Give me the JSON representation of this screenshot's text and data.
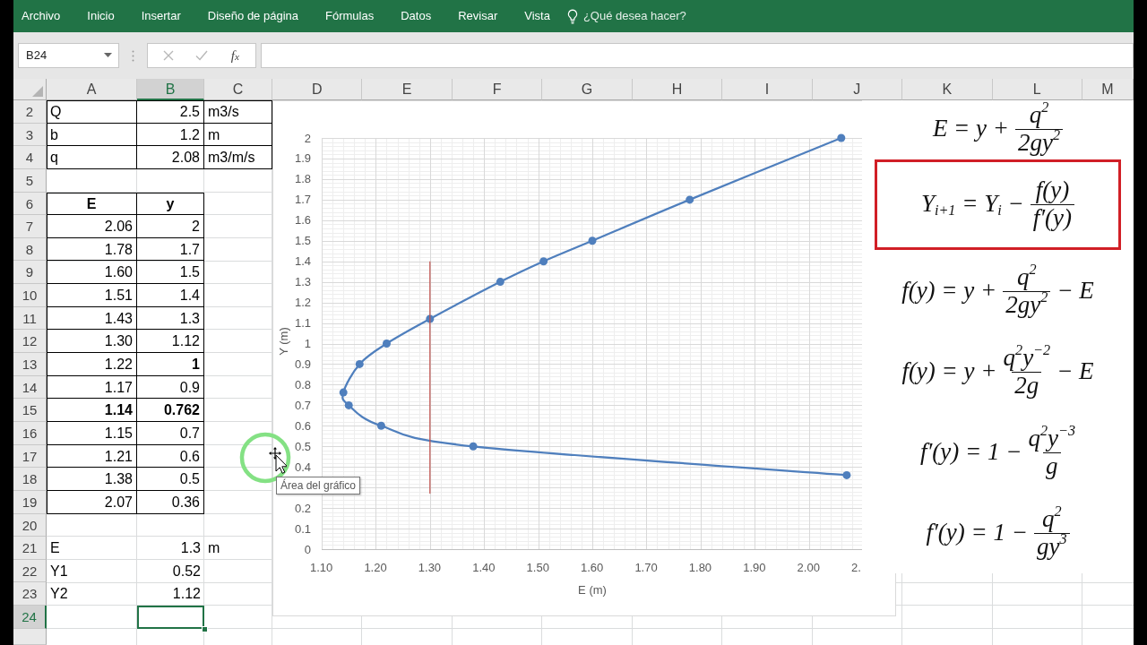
{
  "ribbon": {
    "tabs": [
      {
        "label": "Archivo",
        "selected": false
      },
      {
        "label": "Inicio",
        "selected": false
      },
      {
        "label": "Insertar",
        "selected": false
      },
      {
        "label": "Diseño de página",
        "selected": false
      },
      {
        "label": "Fórmulas",
        "selected": false
      },
      {
        "label": "Datos",
        "selected": false
      },
      {
        "label": "Revisar",
        "selected": false
      },
      {
        "label": "Vista",
        "selected": false
      }
    ],
    "tell_me": {
      "placeholder": "¿Qué desea hacer?"
    }
  },
  "formula_bar": {
    "name_box": "B24",
    "buttons": [
      {
        "kind": "cancel",
        "disabled": true
      },
      {
        "kind": "enter",
        "disabled": true
      },
      {
        "kind": "function",
        "label": "f$_{x}$",
        "disabled": false
      }
    ]
  },
  "sheet": {
    "columns": [
      {
        "label": "A",
        "selected": false
      },
      {
        "label": "B",
        "selected": true
      },
      {
        "label": "C",
        "selected": false
      },
      {
        "label": "D",
        "selected": false
      },
      {
        "label": "E",
        "selected": false
      },
      {
        "label": "F",
        "selected": false
      },
      {
        "label": "G",
        "selected": false
      },
      {
        "label": "H",
        "selected": false
      },
      {
        "label": "I",
        "selected": false
      },
      {
        "label": "J",
        "selected": false
      },
      {
        "label": "K",
        "selected": false
      },
      {
        "label": "L",
        "selected": false
      },
      {
        "label": "M",
        "selected": false
      }
    ],
    "rows": [
      {
        "number": "2",
        "selected": false,
        "cells": [
          {
            "text": "Q",
            "kind": "text",
            "bold": false,
            "border": true
          },
          {
            "text": "2.5",
            "kind": "number",
            "bold": false,
            "border": true
          },
          {
            "text": "m3/s",
            "kind": "text",
            "bold": false,
            "border": true
          }
        ]
      },
      {
        "number": "3",
        "selected": false,
        "cells": [
          {
            "text": "b",
            "kind": "text",
            "bold": false,
            "border": true
          },
          {
            "text": "1.2",
            "kind": "number",
            "bold": false,
            "border": true
          },
          {
            "text": "m",
            "kind": "text",
            "bold": false,
            "border": true
          }
        ]
      },
      {
        "number": "4",
        "selected": false,
        "cells": [
          {
            "text": "q",
            "kind": "text",
            "bold": false,
            "border": true
          },
          {
            "text": "2.08",
            "kind": "number",
            "bold": false,
            "border": true
          },
          {
            "text": "m3/m/s",
            "kind": "text",
            "bold": false,
            "border": true
          }
        ]
      },
      {
        "number": "5",
        "selected": false
      },
      {
        "number": "6",
        "selected": false,
        "cells": [
          {
            "text": "E",
            "kind": "heading",
            "bold": true,
            "border": true
          },
          {
            "text": "y",
            "kind": "heading",
            "bold": true,
            "border": true
          }
        ]
      },
      {
        "number": "7",
        "selected": false,
        "cells": [
          {
            "text": "2.06",
            "kind": "number",
            "bold": false,
            "border": true
          },
          {
            "text": "2",
            "kind": "number",
            "bold": false,
            "border": true
          }
        ]
      },
      {
        "number": "8",
        "selected": false,
        "cells": [
          {
            "text": "1.78",
            "kind": "number",
            "bold": false,
            "border": true
          },
          {
            "text": "1.7",
            "kind": "number",
            "bold": false,
            "border": true
          }
        ]
      },
      {
        "number": "9",
        "selected": false,
        "cells": [
          {
            "text": "1.60",
            "kind": "number",
            "bold": false,
            "border": true
          },
          {
            "text": "1.5",
            "kind": "number",
            "bold": false,
            "border": true
          }
        ]
      },
      {
        "number": "10",
        "selected": false,
        "cells": [
          {
            "text": "1.51",
            "kind": "number",
            "bold": false,
            "border": true
          },
          {
            "text": "1.4",
            "kind": "number",
            "bold": false,
            "border": true
          }
        ]
      },
      {
        "number": "11",
        "selected": false,
        "cells": [
          {
            "text": "1.43",
            "kind": "number",
            "bold": false,
            "border": true
          },
          {
            "text": "1.3",
            "kind": "number",
            "bold": false,
            "border": true
          }
        ]
      },
      {
        "number": "12",
        "selected": false,
        "cells": [
          {
            "text": "1.30",
            "kind": "number",
            "bold": false,
            "border": true
          },
          {
            "text": "1.12",
            "kind": "number",
            "bold": false,
            "border": true
          }
        ]
      },
      {
        "number": "13",
        "selected": false,
        "cells": [
          {
            "text": "1.22",
            "kind": "number",
            "bold": false,
            "border": true
          },
          {
            "text": "1",
            "kind": "number",
            "bold": true,
            "border": true
          }
        ]
      },
      {
        "number": "14",
        "selected": false,
        "cells": [
          {
            "text": "1.17",
            "kind": "number",
            "bold": false,
            "border": true
          },
          {
            "text": "0.9",
            "kind": "number",
            "bold": false,
            "border": true
          }
        ]
      },
      {
        "number": "15",
        "selected": false,
        "cells": [
          {
            "text": "1.14",
            "kind": "number",
            "bold": true,
            "border": true
          },
          {
            "text": "0.762",
            "kind": "number",
            "bold": true,
            "border": true
          }
        ]
      },
      {
        "number": "16",
        "selected": false,
        "cells": [
          {
            "text": "1.15",
            "kind": "number",
            "bold": false,
            "border": true
          },
          {
            "text": "0.7",
            "kind": "number",
            "bold": false,
            "border": true
          }
        ]
      },
      {
        "number": "17",
        "selected": false,
        "cells": [
          {
            "text": "1.21",
            "kind": "number",
            "bold": false,
            "border": true
          },
          {
            "text": "0.6",
            "kind": "number",
            "bold": false,
            "border": true
          }
        ]
      },
      {
        "number": "18",
        "selected": false,
        "cells": [
          {
            "text": "1.38",
            "kind": "number",
            "bold": false,
            "border": true
          },
          {
            "text": "0.5",
            "kind": "number",
            "bold": false,
            "border": true
          }
        ]
      },
      {
        "number": "19",
        "selected": false,
        "cells": [
          {
            "text": "2.07",
            "kind": "number",
            "bold": false,
            "border": true
          },
          {
            "text": "0.36",
            "kind": "number",
            "bold": false,
            "border": true
          }
        ]
      },
      {
        "number": "20",
        "selected": false
      },
      {
        "number": "21",
        "selected": false,
        "cells": [
          {
            "text": "E",
            "kind": "text",
            "bold": false,
            "border": false
          },
          {
            "text": "1.3",
            "kind": "number",
            "bold": false,
            "border": false
          },
          {
            "text": "m",
            "kind": "text",
            "bold": false,
            "border": false
          }
        ]
      },
      {
        "number": "22",
        "selected": false,
        "cells": [
          {
            "text": "Y1",
            "kind": "text",
            "bold": false,
            "border": false
          },
          {
            "text": "0.52",
            "kind": "number",
            "bold": false,
            "border": false
          }
        ]
      },
      {
        "number": "23",
        "selected": false,
        "cells": [
          {
            "text": "Y2",
            "kind": "text",
            "bold": false,
            "border": false
          },
          {
            "text": "1.12",
            "kind": "number",
            "bold": false,
            "border": false
          }
        ]
      },
      {
        "number": "24",
        "selected": true
      }
    ]
  },
  "chart": {
    "chart_data": {
      "type": "line",
      "xlabel": "E (m)",
      "ylabel": "Y (m)",
      "xlim": [
        1.1,
        2.1
      ],
      "ylim": [
        0,
        2
      ],
      "xticks": [
        {
          "value": 1.1,
          "label": "1.10"
        },
        {
          "value": 1.2,
          "label": "1.20"
        },
        {
          "value": 1.3,
          "label": "1.30"
        },
        {
          "value": 1.4,
          "label": "1.40"
        },
        {
          "value": 1.5,
          "label": "1.50"
        },
        {
          "value": 1.6,
          "label": "1.60"
        },
        {
          "value": 1.7,
          "label": "1.70"
        },
        {
          "value": 1.8,
          "label": "1.80"
        },
        {
          "value": 1.9,
          "label": "1.90"
        },
        {
          "value": 2.0,
          "label": "2.00"
        },
        {
          "value": 2.1,
          "label": "2."
        }
      ],
      "yticks": [
        0,
        0.1,
        0.2,
        0.4,
        0.5,
        0.6,
        0.7,
        0.8,
        0.9,
        1,
        1.1,
        1.2,
        1.3,
        1.4,
        1.5,
        1.6,
        1.7,
        1.8,
        1.9,
        2
      ],
      "grid": true,
      "series": [
        {
          "color": "#4f7fbd",
          "marker": "circle",
          "x": [
            2.06,
            1.78,
            1.6,
            1.51,
            1.43,
            1.3,
            1.22,
            1.17,
            1.14,
            1.15,
            1.21,
            1.38,
            2.07
          ],
          "values": [
            2,
            1.7,
            1.5,
            1.4,
            1.3,
            1.12,
            1,
            0.9,
            0.762,
            0.7,
            0.6,
            0.5,
            0.36
          ]
        },
        {
          "color": "#c0504d",
          "x": [
            1.3,
            1.3
          ],
          "values": [
            0.27,
            1.4
          ]
        }
      ]
    },
    "tooltip": "Área del gráfico"
  },
  "equations": [
    {
      "boxed": false,
      "parts": [
        {
          "kind": "text",
          "text": "E = y +"
        },
        {
          "kind": "fraction",
          "num": "q$^{2}$",
          "den": "2gy$^{2}$"
        }
      ]
    },
    {
      "boxed": true,
      "parts": [
        {
          "kind": "text",
          "text": "Y$_{i+1}$ = Y$_{i}$ −"
        },
        {
          "kind": "fraction",
          "num": "f(y)",
          "den": "f′(y)"
        }
      ]
    },
    {
      "boxed": false,
      "parts": [
        {
          "kind": "text",
          "text": "f(y) = y +"
        },
        {
          "kind": "fraction",
          "num": "q$^{2}$",
          "den": "2gy$^{2}$"
        },
        {
          "kind": "text",
          "text": "− E"
        }
      ]
    },
    {
      "boxed": false,
      "parts": [
        {
          "kind": "text",
          "text": "f(y) = y +"
        },
        {
          "kind": "fraction",
          "num": "q$^{2}$y$^{−2}$",
          "den": "2g"
        },
        {
          "kind": "text",
          "text": "− E"
        }
      ]
    },
    {
      "boxed": false,
      "parts": [
        {
          "kind": "text",
          "text": "f′(y) = 1 −"
        },
        {
          "kind": "fraction",
          "num": "q$^{2}$y$^{−3}$",
          "den": "g"
        }
      ]
    },
    {
      "boxed": false,
      "parts": [
        {
          "kind": "text",
          "text": "f′(y) = 1 −"
        },
        {
          "kind": "fraction",
          "num": "q$^{2}$",
          "den": "gy$^{3}$"
        }
      ]
    }
  ]
}
